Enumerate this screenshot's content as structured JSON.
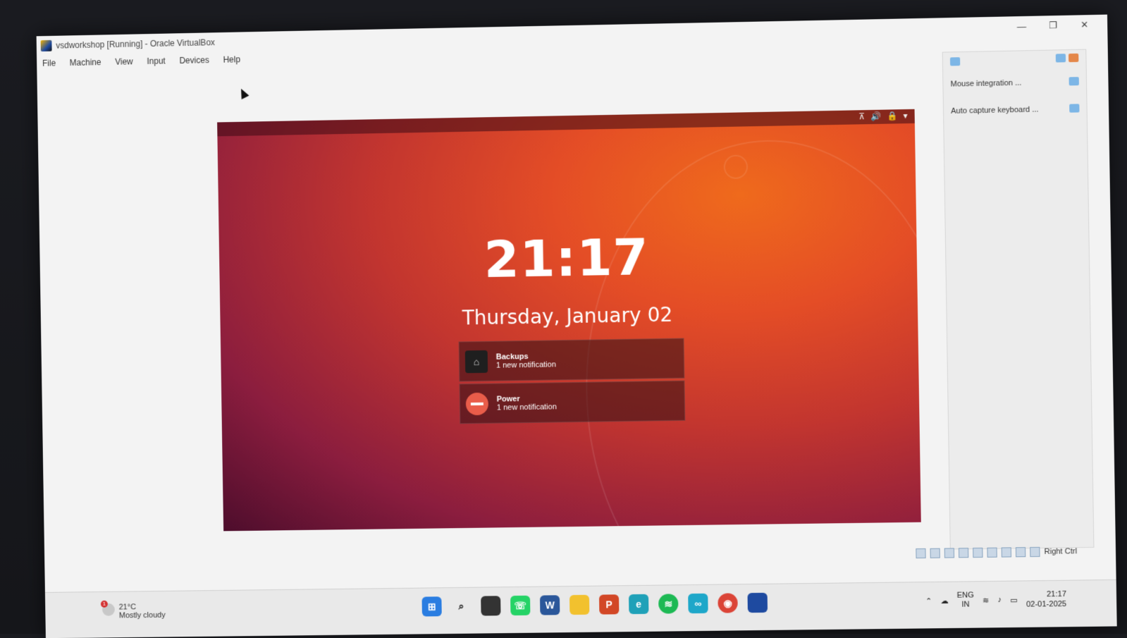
{
  "window": {
    "title": "vsdworkshop [Running] - Oracle VirtualBox",
    "controls": [
      "—",
      "❐",
      "✕"
    ]
  },
  "menubar": {
    "items": [
      "File",
      "Machine",
      "View",
      "Input",
      "Devices",
      "Help"
    ]
  },
  "vm": {
    "lock_screen": {
      "time": "21:17",
      "date": "Thursday, January 02"
    },
    "notifications": [
      {
        "title": "Backups",
        "subtitle": "1 new notification",
        "icon": "backup-icon"
      },
      {
        "title": "Power",
        "subtitle": "1 new notification",
        "icon": "power-icon"
      }
    ],
    "tray_icons": [
      "network-icon",
      "volume-icon",
      "lock-icon",
      "chevron-down-icon"
    ]
  },
  "side_panel": {
    "items": [
      "Mouse integration ...",
      "Auto capture keyboard ..."
    ]
  },
  "statusbar": {
    "host_key": "Right Ctrl"
  },
  "taskbar": {
    "weather": {
      "temp": "21°C",
      "desc": "Mostly cloudy",
      "badge": "1"
    },
    "apps": [
      "windows-start",
      "search",
      "task-view",
      "whatsapp",
      "word",
      "file-explorer",
      "powerpoint",
      "edge",
      "spotify",
      "app-infinity",
      "chrome",
      "virtualbox"
    ],
    "language": {
      "lang": "ENG",
      "region": "IN"
    },
    "clock": {
      "time": "21:17",
      "date": "02-01-2025"
    }
  }
}
